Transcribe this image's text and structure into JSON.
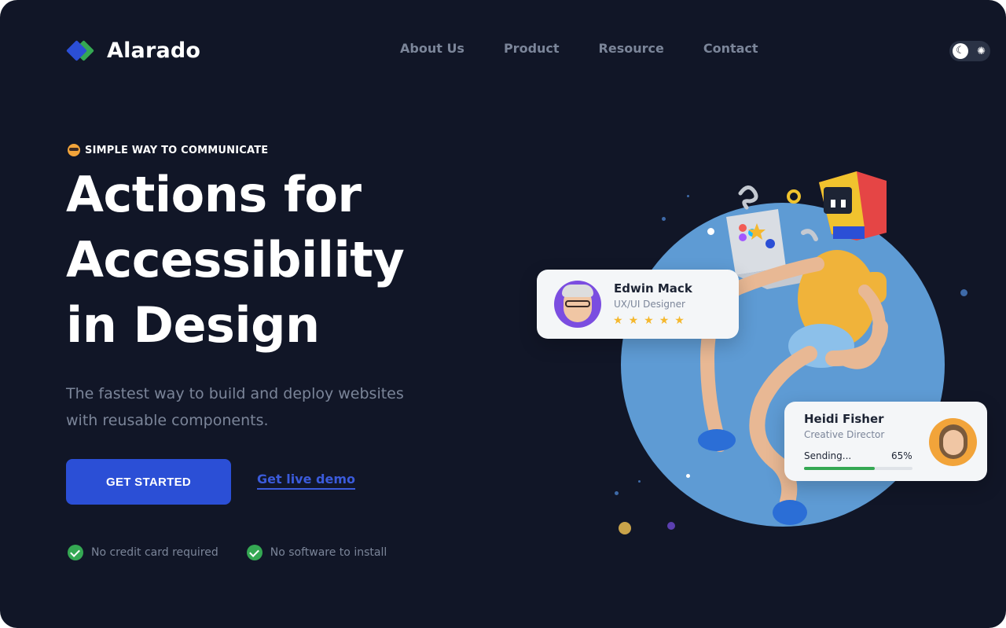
{
  "brand": {
    "name": "Alarado"
  },
  "nav": {
    "items": [
      "About Us",
      "Product",
      "Resource",
      "Contact"
    ]
  },
  "theme_toggle": {
    "dark_icon": "moon-icon",
    "light_icon": "sun-icon"
  },
  "hero": {
    "eyebrow": "SIMPLE WAY TO COMMUNICATE",
    "headline_lines": [
      "Actions for",
      "Accessibility",
      "in Design"
    ],
    "subtext": "The fastest way to build and deploy websites with reusable components.",
    "cta_label": "GET STARTED",
    "demo_label": "Get live demo",
    "checks": [
      "No credit card required",
      "No software to install"
    ]
  },
  "cards": {
    "edwin": {
      "name": "Edwin Mack",
      "role": "UX/UI Designer",
      "rating": 5
    },
    "heidi": {
      "name": "Heidi Fisher",
      "role": "Creative Director",
      "status": "Sending...",
      "progress_text": "65%",
      "progress": 0.65
    }
  },
  "colors": {
    "background": "#111627",
    "accent": "#2b4fd6",
    "success": "#35a853",
    "muted_text": "#7b8599",
    "circle": "#5e9bd4"
  }
}
